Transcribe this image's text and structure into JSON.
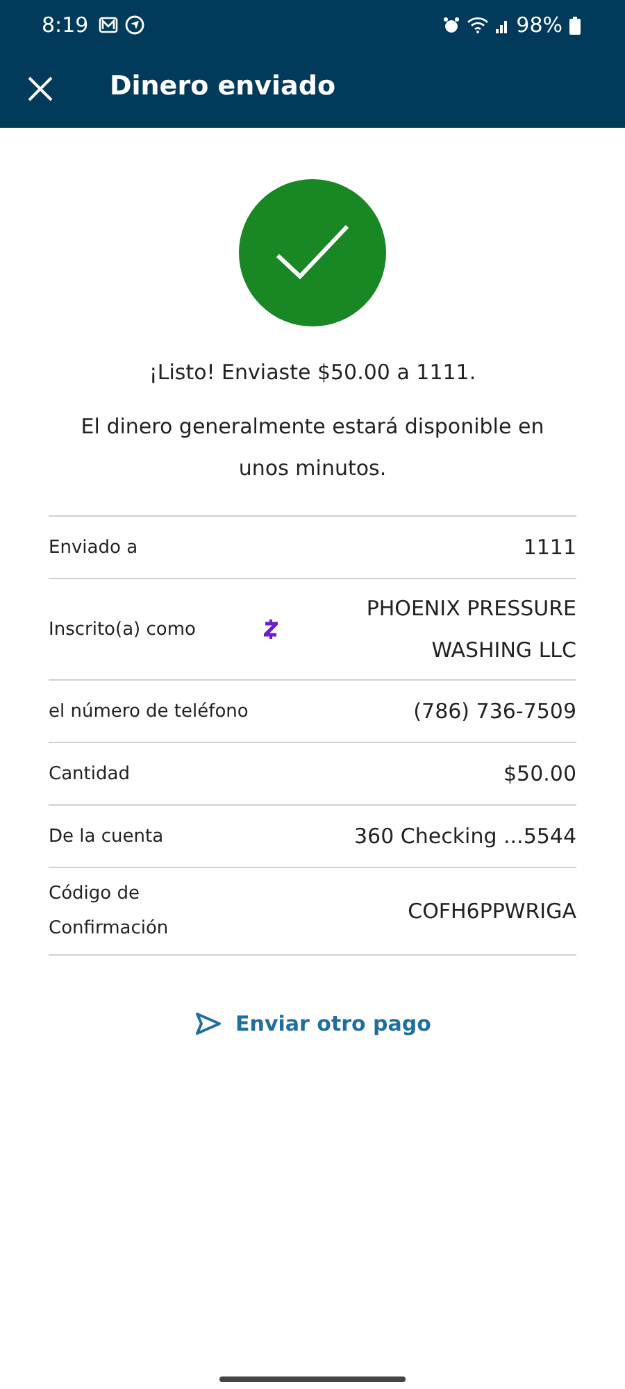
{
  "status_bar": {
    "time": "8:19",
    "battery": "98%"
  },
  "header": {
    "title": "Dinero enviado"
  },
  "message": "¡Listo! Enviaste $50.00 a 1111.",
  "note": "El dinero generalmente estará disponible en unos minutos.",
  "details": [
    {
      "kind": "plain",
      "label": "Enviado a",
      "value": "1111"
    },
    {
      "kind": "logo",
      "label": "Inscrito(a) como",
      "value": "PHOENIX PRESSURE WASHING LLC"
    },
    {
      "kind": "plain",
      "label": "el número de teléfono",
      "value": "(786) 736-7509"
    },
    {
      "kind": "plain",
      "label": "Cantidad",
      "value": "$50.00"
    },
    {
      "kind": "plain",
      "label": "De la cuenta",
      "value": "360 Checking ...5544"
    },
    {
      "kind": "plain",
      "label": "Código de Confirmación",
      "value": "COFH6PPWRIGA"
    }
  ],
  "action": "Enviar otro pago"
}
